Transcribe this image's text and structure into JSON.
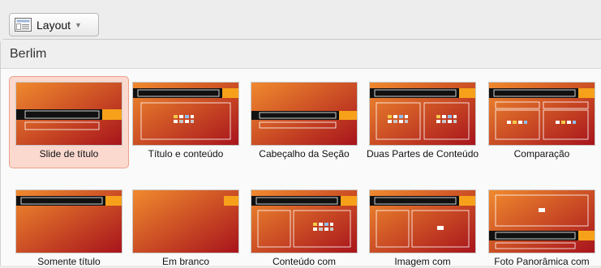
{
  "toolbar": {
    "layout_label": "Layout",
    "caret": "▼",
    "icon": "layout-icon"
  },
  "section": {
    "title": "Berlim"
  },
  "layouts": [
    {
      "label": "Slide de título",
      "selected": true
    },
    {
      "label": "Título e conteúdo",
      "selected": false
    },
    {
      "label": "Cabeçalho da Seção",
      "selected": false
    },
    {
      "label": "Duas Partes de Conteúdo",
      "selected": false
    },
    {
      "label": "Comparação",
      "selected": false
    },
    {
      "label": "Somente título",
      "selected": false
    },
    {
      "label": "Em branco",
      "selected": false
    },
    {
      "label": "Conteúdo com",
      "selected": false
    },
    {
      "label": "Imagem com",
      "selected": false
    },
    {
      "label": "Foto Panorâmica com",
      "selected": false
    }
  ],
  "colors": {
    "thumb_light": "#f08a2e",
    "thumb_dark": "#a8141c",
    "accent_orange": "#f7a11b",
    "selection_fill": "#fbd9cf",
    "selection_border": "#eb9f8c"
  }
}
